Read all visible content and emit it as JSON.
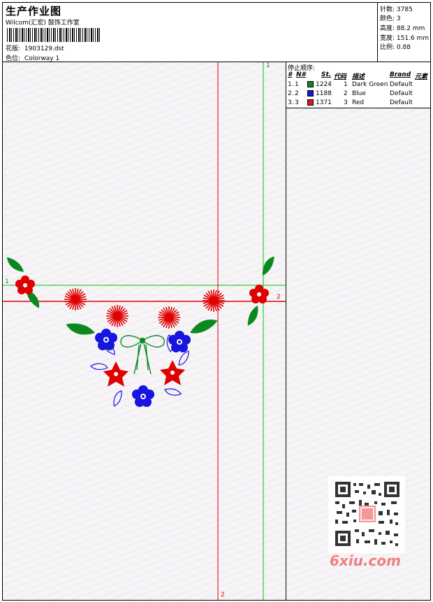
{
  "header": {
    "title": "生产作业图",
    "company": "Wilcom(汇宏) 鼓饰工作室",
    "design_label": "花版:",
    "design_value": "1903129.dst",
    "colorway_label": "色位:",
    "colorway_value": "Colorway 1"
  },
  "stats": [
    {
      "label": "针数:",
      "value": "3785"
    },
    {
      "label": "颜色:",
      "value": "3"
    },
    {
      "label": "高度:",
      "value": "88.2 mm"
    },
    {
      "label": "宽度:",
      "value": "151.6 mm"
    },
    {
      "label": "比例:",
      "value": "0.88"
    }
  ],
  "stop_sequence": {
    "title": "停止顺序:",
    "headers": [
      "#",
      "N#",
      "St.",
      "代码",
      "描述",
      "Brand",
      "元素"
    ],
    "rows": [
      {
        "idx": "1.",
        "n": "1",
        "st": "1224",
        "code": "1",
        "desc": "Dark Green",
        "brand": "Default",
        "color": "#0a8a1e"
      },
      {
        "idx": "2.",
        "n": "2",
        "st": "1188",
        "code": "2",
        "desc": "Blue",
        "brand": "Default",
        "color": "#1616e0"
      },
      {
        "idx": "3.",
        "n": "3",
        "st": "1371",
        "code": "3",
        "desc": "Red",
        "brand": "Default",
        "color": "#e01616"
      }
    ]
  },
  "guides": {
    "green_v_label": "1",
    "green_h_label": "1",
    "red_v_label": "2",
    "red_h_label": "2"
  },
  "watermark": "6xiu.com",
  "colors": {
    "green": "#00c800",
    "red": "#e00000",
    "blue": "#1616e0",
    "dark_green": "#0a8a1e"
  }
}
